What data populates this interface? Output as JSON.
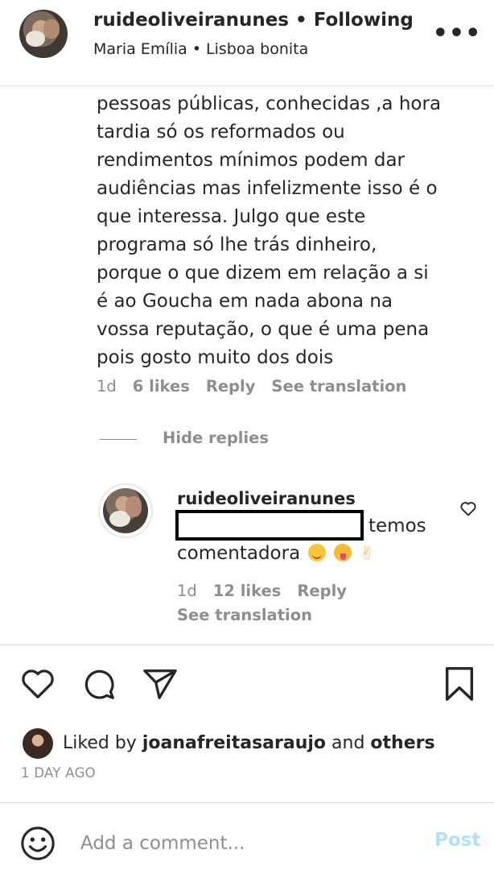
{
  "header": {
    "username": "ruideoliveiranunes",
    "separator": "•",
    "follow_status": "Following",
    "audio_artist": "Maria Emília",
    "audio_title": "Lisboa bonita"
  },
  "comment": {
    "lines": [
      "pessoas públicas, conhecidas ,a hora",
      "tardia só os reformados ou",
      "rendimentos mínimos podem dar",
      "audiências mas infelizmente isso é o",
      "que interessa. Julgo que este",
      "programa só lhe trás dinheiro,",
      "porque o que dizem em relação a si",
      "é ao Goucha em nada abona na",
      "vossa reputação, o que é uma pena",
      "pois gosto muito dos dois"
    ],
    "time": "1d",
    "likes": "6 likes",
    "reply_label": "Reply",
    "translate_label": "See translation"
  },
  "hide_replies_label": "Hide replies",
  "reply": {
    "username": "ruideoliveiranunes",
    "text_part1": "temos",
    "text_part2": "comentadora",
    "time": "1d",
    "likes": "12 likes",
    "reply_label": "Reply",
    "translate_label": "See translation"
  },
  "likes_summary": {
    "prefix": "Liked by",
    "user": "joanafreitasaraujo",
    "connector": "and",
    "others": "others"
  },
  "post_age": "1 DAY AGO",
  "comment_box": {
    "placeholder": "Add a comment...",
    "post_label": "Post"
  },
  "icons": {
    "more": "more-options-icon",
    "like": "heart-icon",
    "comment": "comment-icon",
    "share": "send-icon",
    "save": "bookmark-icon",
    "emoji": "emoji-icon"
  },
  "colors": {
    "text": "#262626",
    "secondary": "#8e8e8e",
    "post_disabled": "#b2dffc",
    "divider": "#dbdbdb"
  }
}
